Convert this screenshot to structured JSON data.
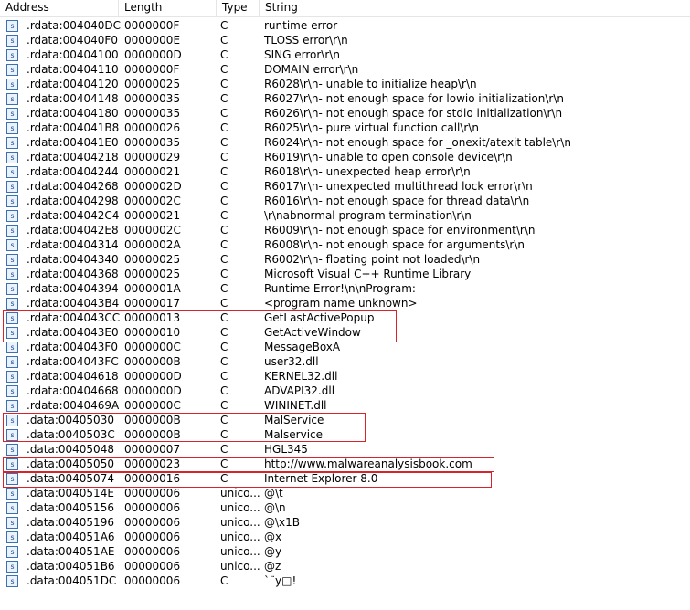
{
  "header": {
    "address": "Address",
    "length": "Length",
    "type": "Type",
    "string": "String"
  },
  "row_icon": "s",
  "rows": [
    {
      "address": ".rdata:004040DC",
      "length": "0000000F",
      "type": "C",
      "string": "runtime error"
    },
    {
      "address": ".rdata:004040F0",
      "length": "0000000E",
      "type": "C",
      "string": "TLOSS error\\r\\n"
    },
    {
      "address": ".rdata:00404100",
      "length": "0000000D",
      "type": "C",
      "string": "SING error\\r\\n"
    },
    {
      "address": ".rdata:00404110",
      "length": "0000000F",
      "type": "C",
      "string": "DOMAIN error\\r\\n"
    },
    {
      "address": ".rdata:00404120",
      "length": "00000025",
      "type": "C",
      "string": "R6028\\r\\n- unable to initialize heap\\r\\n"
    },
    {
      "address": ".rdata:00404148",
      "length": "00000035",
      "type": "C",
      "string": "R6027\\r\\n- not enough space for lowio initialization\\r\\n"
    },
    {
      "address": ".rdata:00404180",
      "length": "00000035",
      "type": "C",
      "string": "R6026\\r\\n- not enough space for stdio initialization\\r\\n"
    },
    {
      "address": ".rdata:004041B8",
      "length": "00000026",
      "type": "C",
      "string": "R6025\\r\\n- pure virtual function call\\r\\n"
    },
    {
      "address": ".rdata:004041E0",
      "length": "00000035",
      "type": "C",
      "string": "R6024\\r\\n- not enough space for _onexit/atexit table\\r\\n"
    },
    {
      "address": ".rdata:00404218",
      "length": "00000029",
      "type": "C",
      "string": "R6019\\r\\n- unable to open console device\\r\\n"
    },
    {
      "address": ".rdata:00404244",
      "length": "00000021",
      "type": "C",
      "string": "R6018\\r\\n- unexpected heap error\\r\\n"
    },
    {
      "address": ".rdata:00404268",
      "length": "0000002D",
      "type": "C",
      "string": "R6017\\r\\n- unexpected multithread lock error\\r\\n"
    },
    {
      "address": ".rdata:00404298",
      "length": "0000002C",
      "type": "C",
      "string": "R6016\\r\\n- not enough space for thread data\\r\\n"
    },
    {
      "address": ".rdata:004042C4",
      "length": "00000021",
      "type": "C",
      "string": "\\r\\nabnormal program termination\\r\\n"
    },
    {
      "address": ".rdata:004042E8",
      "length": "0000002C",
      "type": "C",
      "string": "R6009\\r\\n- not enough space for environment\\r\\n"
    },
    {
      "address": ".rdata:00404314",
      "length": "0000002A",
      "type": "C",
      "string": "R6008\\r\\n- not enough space for arguments\\r\\n"
    },
    {
      "address": ".rdata:00404340",
      "length": "00000025",
      "type": "C",
      "string": "R6002\\r\\n- floating point not loaded\\r\\n"
    },
    {
      "address": ".rdata:00404368",
      "length": "00000025",
      "type": "C",
      "string": "Microsoft Visual C++ Runtime Library"
    },
    {
      "address": ".rdata:00404394",
      "length": "0000001A",
      "type": "C",
      "string": "Runtime Error!\\n\\nProgram: "
    },
    {
      "address": ".rdata:004043B4",
      "length": "00000017",
      "type": "C",
      "string": "<program name unknown>"
    },
    {
      "address": ".rdata:004043CC",
      "length": "00000013",
      "type": "C",
      "string": "GetLastActivePopup"
    },
    {
      "address": ".rdata:004043E0",
      "length": "00000010",
      "type": "C",
      "string": "GetActiveWindow"
    },
    {
      "address": ".rdata:004043F0",
      "length": "0000000C",
      "type": "C",
      "string": "MessageBoxA"
    },
    {
      "address": ".rdata:004043FC",
      "length": "0000000B",
      "type": "C",
      "string": "user32.dll"
    },
    {
      "address": ".rdata:00404618",
      "length": "0000000D",
      "type": "C",
      "string": "KERNEL32.dll"
    },
    {
      "address": ".rdata:00404668",
      "length": "0000000D",
      "type": "C",
      "string": "ADVAPI32.dll"
    },
    {
      "address": ".rdata:0040469A",
      "length": "0000000C",
      "type": "C",
      "string": "WININET.dll"
    },
    {
      "address": ".data:00405030",
      "length": "0000000B",
      "type": "C",
      "string": "MalService"
    },
    {
      "address": ".data:0040503C",
      "length": "0000000B",
      "type": "C",
      "string": "Malservice"
    },
    {
      "address": ".data:00405048",
      "length": "00000007",
      "type": "C",
      "string": "HGL345"
    },
    {
      "address": ".data:00405050",
      "length": "00000023",
      "type": "C",
      "string": "http://www.malwareanalysisbook.com"
    },
    {
      "address": ".data:00405074",
      "length": "00000016",
      "type": "C",
      "string": "Internet Explorer 8.0"
    },
    {
      "address": ".data:0040514E",
      "length": "00000006",
      "type": "unico...",
      "string": "@\\t"
    },
    {
      "address": ".data:00405156",
      "length": "00000006",
      "type": "unico...",
      "string": "@\\n"
    },
    {
      "address": ".data:00405196",
      "length": "00000006",
      "type": "unico...",
      "string": "@\\x1B"
    },
    {
      "address": ".data:004051A6",
      "length": "00000006",
      "type": "unico...",
      "string": "@x"
    },
    {
      "address": ".data:004051AE",
      "length": "00000006",
      "type": "unico...",
      "string": "@y"
    },
    {
      "address": ".data:004051B6",
      "length": "00000006",
      "type": "unico...",
      "string": "@z"
    },
    {
      "address": ".data:004051DC",
      "length": "00000006",
      "type": "C",
      "string": "`¨y□!"
    }
  ],
  "highlight_color": "#d8232a"
}
